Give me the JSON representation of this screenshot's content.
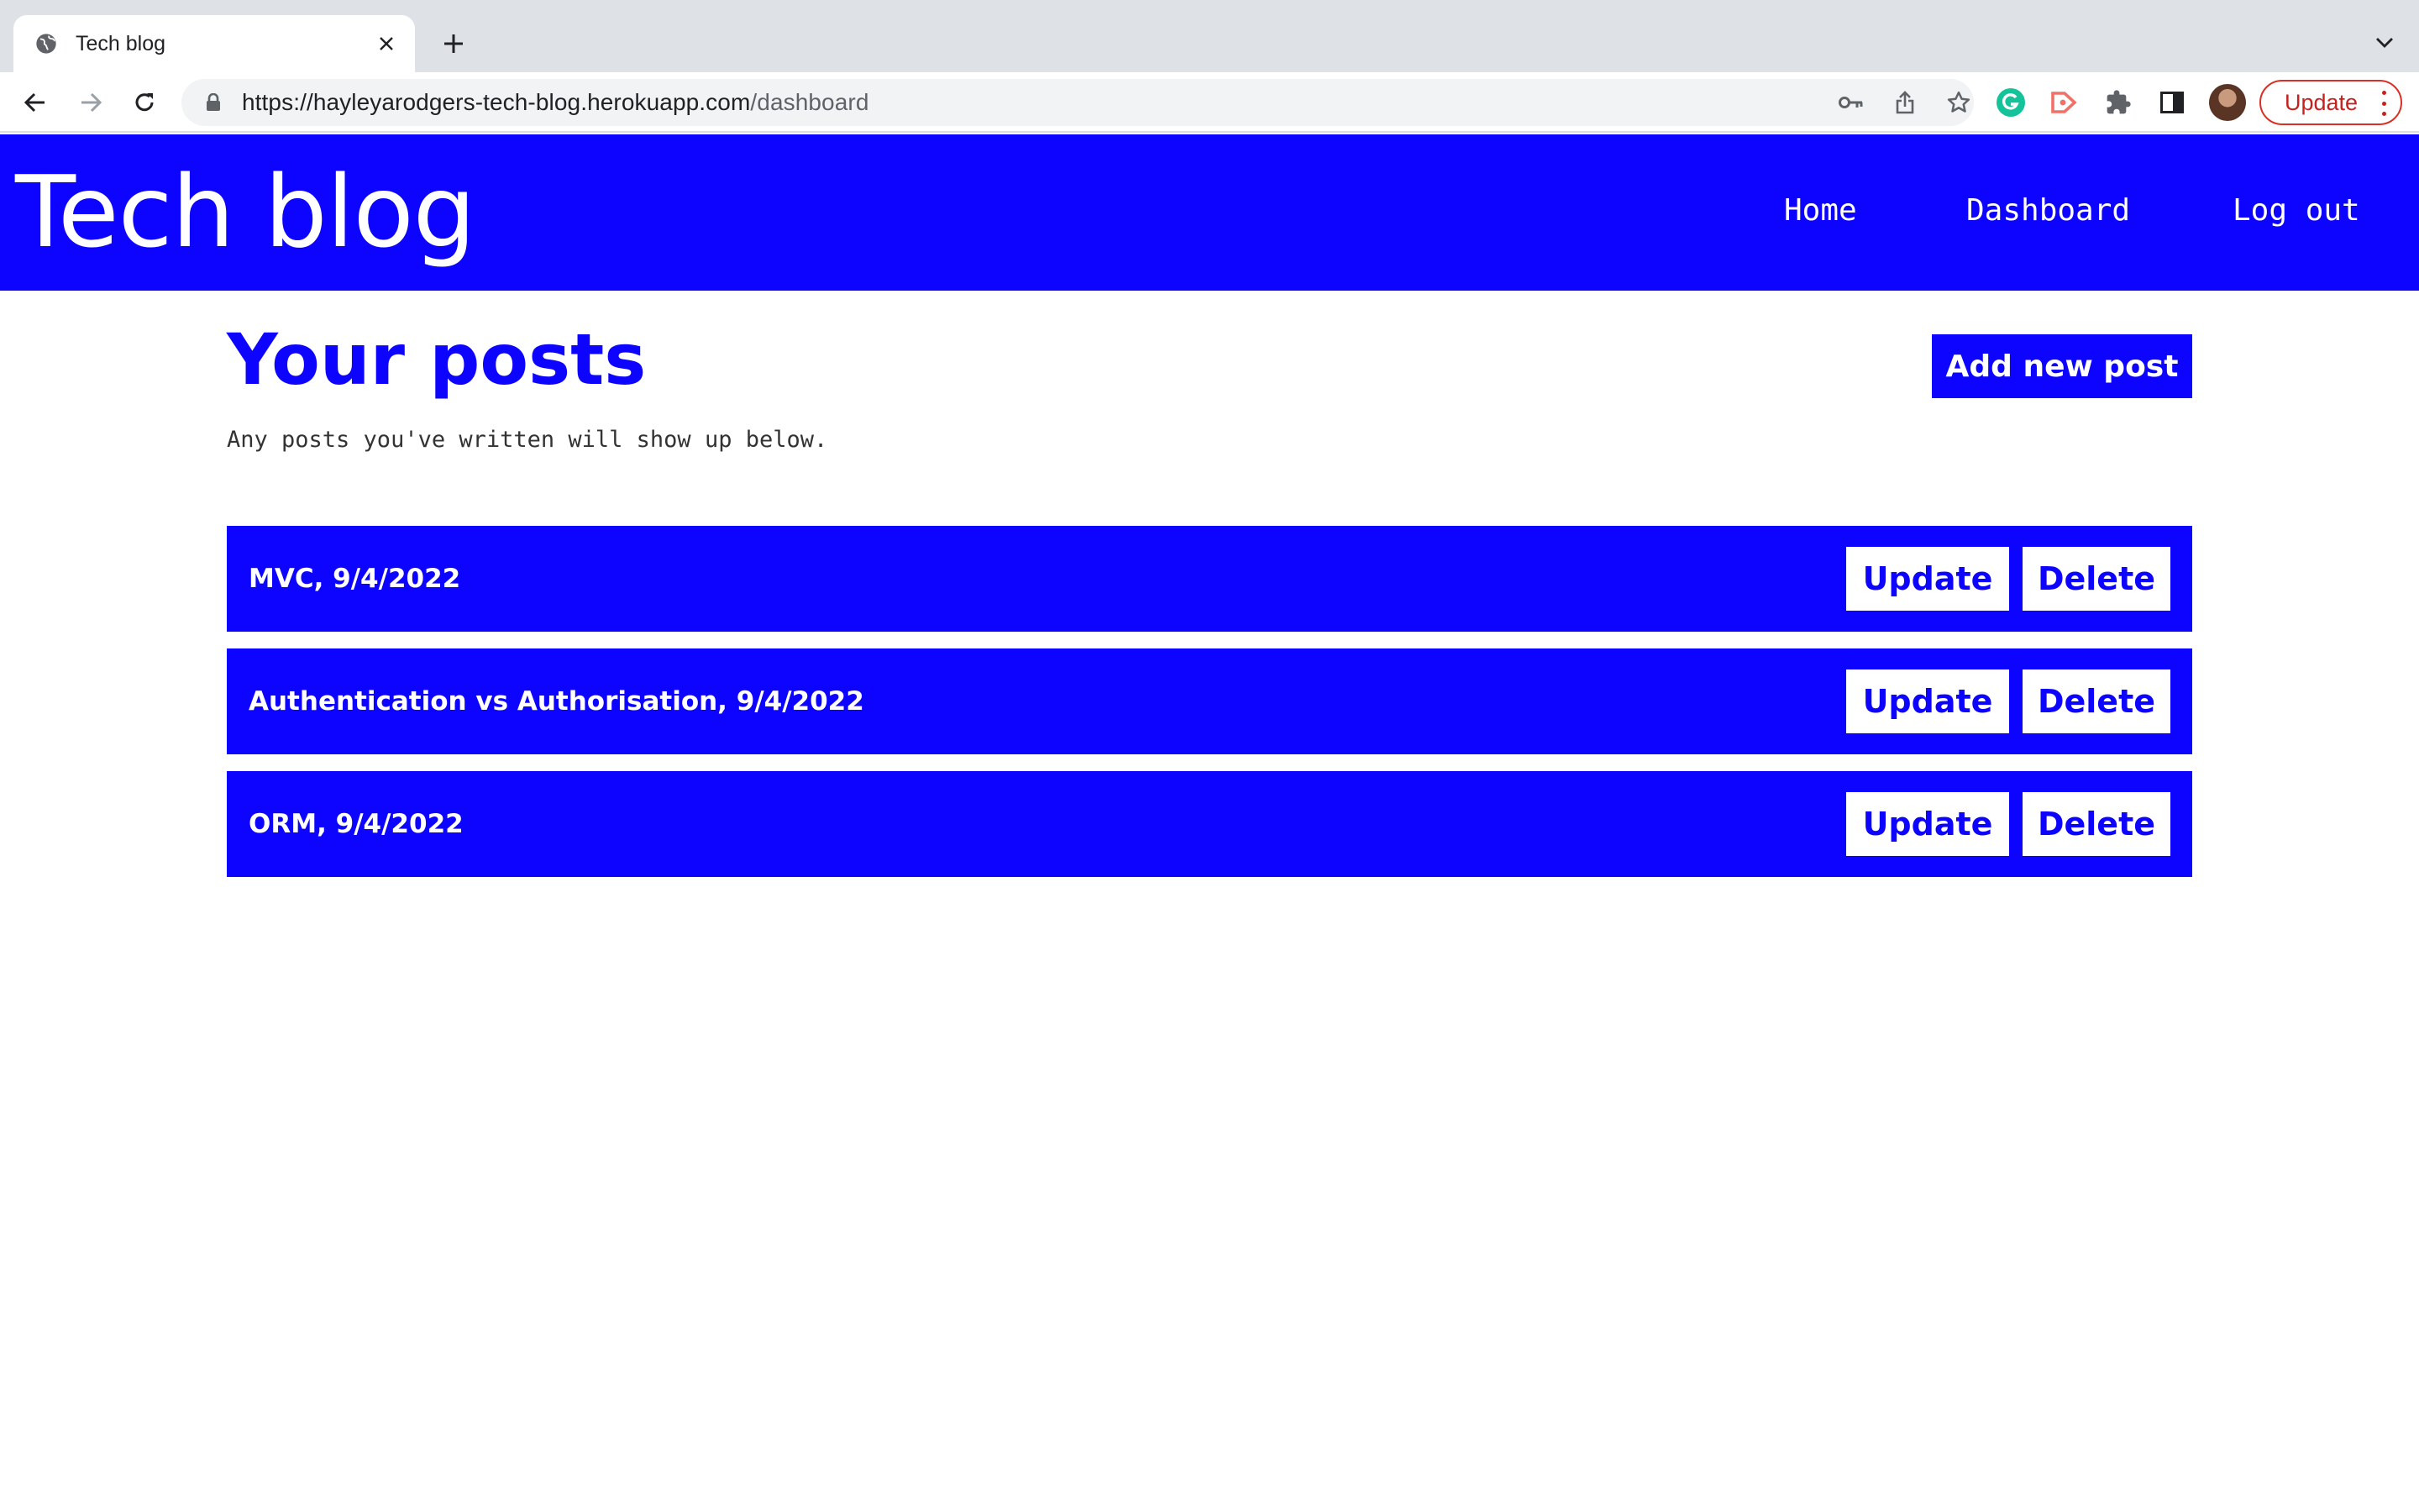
{
  "browser": {
    "tab": {
      "title": "Tech blog",
      "favicon": "globe-icon"
    },
    "url": {
      "domain": "https://hayleyarodgers-tech-blog.herokuapp.com",
      "path": "/dashboard"
    },
    "update_label": "Update",
    "extensions": [
      "grammarly-icon",
      "cast-icon",
      "extensions-icon",
      "side-panel-icon"
    ]
  },
  "header": {
    "brand": "Tech blog",
    "nav": [
      {
        "label": "Home"
      },
      {
        "label": "Dashboard"
      },
      {
        "label": "Log out"
      }
    ],
    "background_color": "#0c04ff"
  },
  "dashboard": {
    "title": "Your posts",
    "subtitle": "Any posts you've written will show up below.",
    "add_button": "Add new post",
    "posts": [
      {
        "title": "MVC, 9/4/2022",
        "update_label": "Update",
        "delete_label": "Delete"
      },
      {
        "title": "Authentication vs Authorisation, 9/4/2022",
        "update_label": "Update",
        "delete_label": "Delete"
      },
      {
        "title": "ORM, 9/4/2022",
        "update_label": "Update",
        "delete_label": "Delete"
      }
    ]
  },
  "colors": {
    "accent": "#0c04ff",
    "text_on_accent": "#ffffff",
    "chrome_update": "#c5221f"
  }
}
